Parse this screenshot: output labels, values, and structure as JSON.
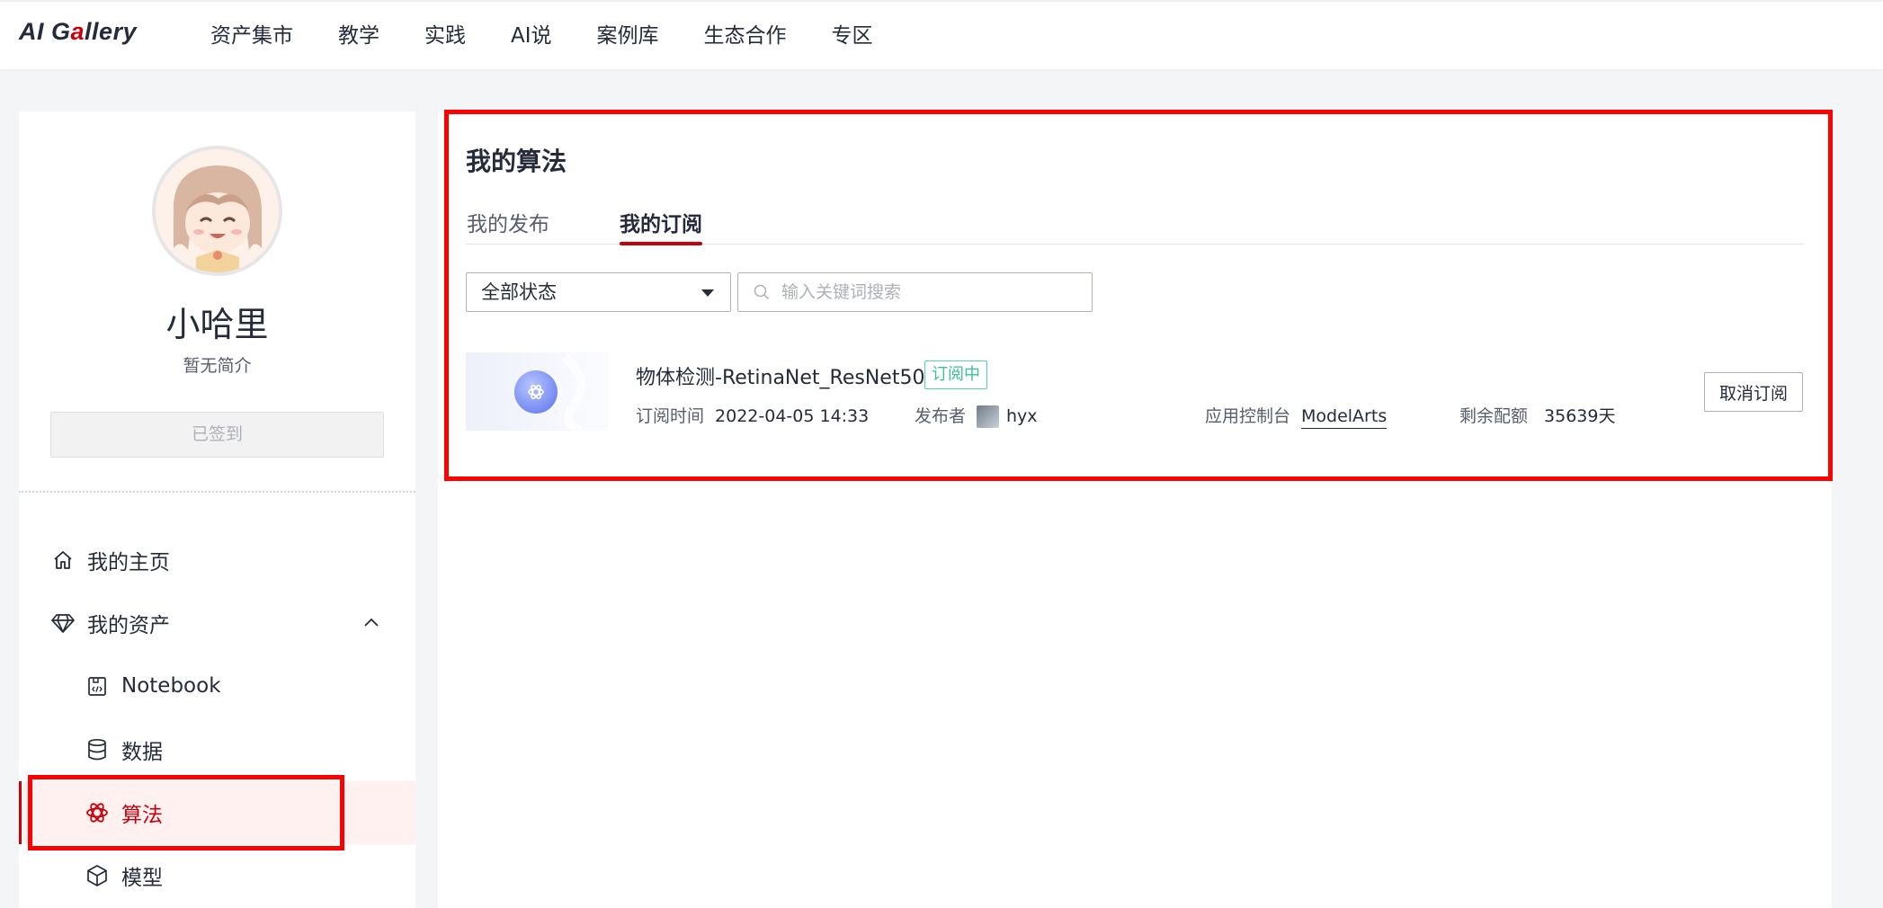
{
  "header": {
    "logo": {
      "text_main": "AI G",
      "text_dot": "a",
      "text_rest": "llery"
    },
    "nav": [
      {
        "label": "资产集市"
      },
      {
        "label": "教学"
      },
      {
        "label": "实践"
      },
      {
        "label": "AI说"
      },
      {
        "label": "案例库"
      },
      {
        "label": "生态合作"
      },
      {
        "label": "专区"
      }
    ]
  },
  "profile": {
    "name": "小哈里",
    "bio": "暂无简介",
    "signin_label": "已签到"
  },
  "sidebar": {
    "items": [
      {
        "label": "我的主页",
        "icon": "home-icon"
      },
      {
        "label": "我的资产",
        "icon": "diamond-icon",
        "expanded": true
      },
      {
        "label": "Notebook",
        "icon": "notebook-icon"
      },
      {
        "label": "数据",
        "icon": "database-icon"
      },
      {
        "label": "算法",
        "icon": "algorithm-icon",
        "active": true
      },
      {
        "label": "模型",
        "icon": "cube-icon"
      }
    ]
  },
  "main": {
    "title": "我的算法",
    "tabs": [
      {
        "label": "我的发布",
        "active": false
      },
      {
        "label": "我的订阅",
        "active": true
      }
    ],
    "filter": {
      "selected": "全部状态"
    },
    "search": {
      "placeholder": "输入关键词搜索"
    },
    "items": [
      {
        "title": "物体检测-RetinaNet_ResNet50",
        "status": "订阅中",
        "subscribe_time_label": "订阅时间",
        "subscribe_time": "2022-04-05 14:33",
        "publisher_label": "发布者",
        "publisher": "hyx",
        "console_label": "应用控制台",
        "console": "ModelArts",
        "quota_label": "剩余配额",
        "quota": "35639天",
        "action": "取消订阅"
      }
    ]
  },
  "colors": {
    "brand": "#c7000b",
    "status_green": "#3ac295",
    "highlight_box": "#ff0000"
  }
}
